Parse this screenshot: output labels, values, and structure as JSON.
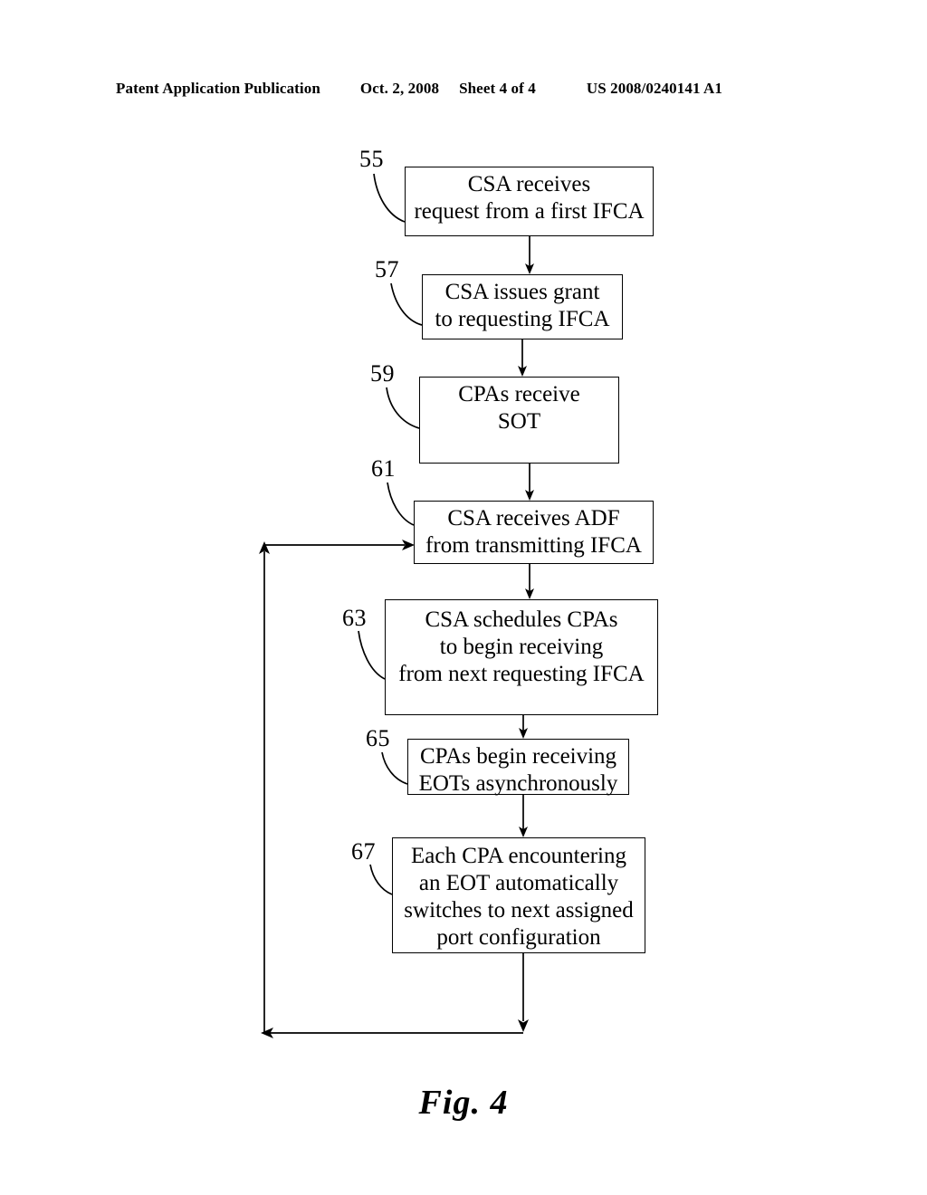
{
  "header": {
    "publication": "Patent Application Publication",
    "date": "Oct. 2, 2008",
    "sheet": "Sheet 4 of 4",
    "patent_number": "US 2008/0240141 A1"
  },
  "figure": {
    "caption": "Fig. 4",
    "steps": [
      {
        "ref": "55",
        "text": "CSA receives\nrequest from a first IFCA",
        "name": "step-55-csa-receives-request"
      },
      {
        "ref": "57",
        "text": "CSA issues grant\nto requesting IFCA",
        "name": "step-57-csa-issues-grant"
      },
      {
        "ref": "59",
        "text": "CPAs receive\nSOT",
        "name": "step-59-cpas-receive-sot"
      },
      {
        "ref": "61",
        "text": "CSA receives ADF\nfrom transmitting IFCA",
        "name": "step-61-csa-receives-adf"
      },
      {
        "ref": "63",
        "text": "CSA schedules CPAs\nto begin receiving\nfrom next requesting IFCA",
        "name": "step-63-csa-schedules-cpas"
      },
      {
        "ref": "65",
        "text": "CPAs begin receiving\nEOTs asynchronously",
        "name": "step-65-cpas-begin-receiving"
      },
      {
        "ref": "67",
        "text": "Each CPA encountering\nan EOT automatically\nswitches to next assigned\nport configuration",
        "name": "step-67-each-cpa-encountering"
      }
    ],
    "connectors": [
      {
        "from": "55",
        "to": "57",
        "kind": "arrow-down"
      },
      {
        "from": "57",
        "to": "59",
        "kind": "arrow-down"
      },
      {
        "from": "59",
        "to": "61",
        "kind": "arrow-down"
      },
      {
        "from": "61",
        "to": "63",
        "kind": "arrow-down"
      },
      {
        "from": "63",
        "to": "65",
        "kind": "arrow-down"
      },
      {
        "from": "65",
        "to": "67",
        "kind": "arrow-down"
      },
      {
        "from": "67",
        "to": "61",
        "kind": "feedback-loop-left"
      }
    ]
  },
  "colors": {
    "ink": "#000000",
    "paper": "#ffffff"
  }
}
